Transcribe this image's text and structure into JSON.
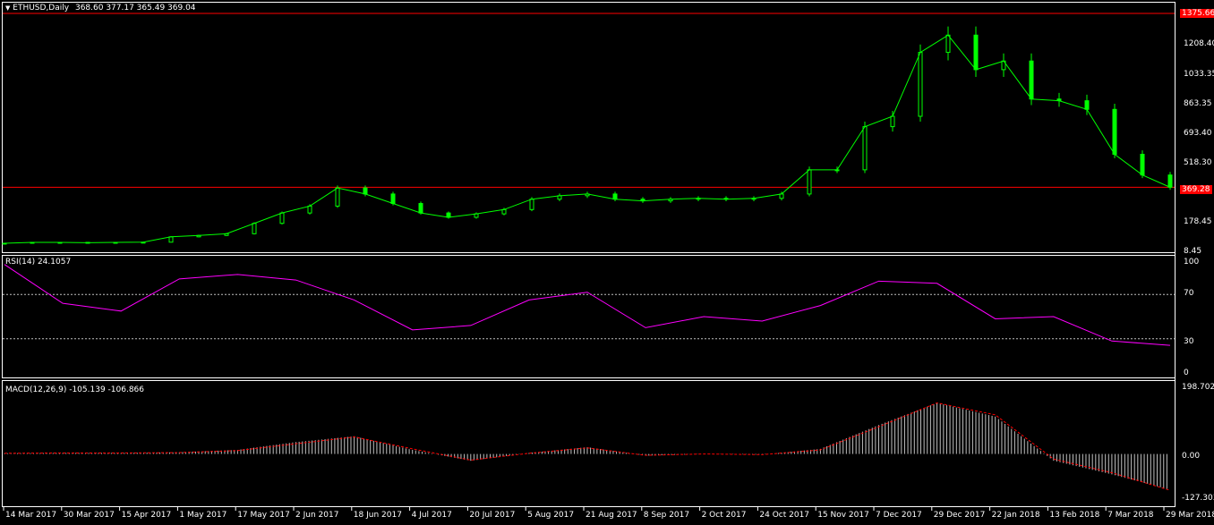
{
  "main": {
    "symbol_label": "ETHUSD,Daily",
    "ohlc_label": "368.60 377.17 365.49 369.04",
    "price_ticks": [
      "1208.40",
      "1033.35",
      "863.35",
      "693.40",
      "518.30",
      "178.45",
      "8.45"
    ],
    "price_tags": {
      "high": "1375.66",
      "low": "369.28"
    },
    "line_color": "#ff0000",
    "candle_color": "#00ff00"
  },
  "rsi": {
    "label": "RSI(14) 24.1057",
    "ticks": [
      "100",
      "70",
      "30",
      "0"
    ],
    "color": "#ff00ff"
  },
  "macd": {
    "label": "MACD(12,26,9) -105.139 -106.866",
    "ticks": [
      "198.702",
      "0.00",
      "-127.303"
    ],
    "signal_color": "#ff0000"
  },
  "x_axis": {
    "labels": [
      "14 Mar 2017",
      "30 Mar 2017",
      "15 Apr 2017",
      "1 May 2017",
      "17 May 2017",
      "2 Jun 2017",
      "18 Jun 2017",
      "4 Jul 2017",
      "20 Jul 2017",
      "5 Aug 2017",
      "21 Aug 2017",
      "8 Sep 2017",
      "2 Oct 2017",
      "24 Oct 2017",
      "15 Nov 2017",
      "7 Dec 2017",
      "29 Dec 2017",
      "22 Jan 2018",
      "13 Feb 2018",
      "7 Mar 2018",
      "29 Mar 2018"
    ]
  },
  "chart_data": [
    {
      "type": "line",
      "name": "ETHUSD,Daily",
      "ylim": [
        8.45,
        1375.66
      ],
      "x": [
        "14 Mar 2017",
        "22 Mar 2017",
        "30 Mar 2017",
        "7 Apr 2017",
        "15 Apr 2017",
        "23 Apr 2017",
        "1 May 2017",
        "9 May 2017",
        "17 May 2017",
        "25 May 2017",
        "2 Jun 2017",
        "10 Jun 2017",
        "18 Jun 2017",
        "26 Jun 2017",
        "4 Jul 2017",
        "12 Jul 2017",
        "20 Jul 2017",
        "28 Jul 2017",
        "5 Aug 2017",
        "13 Aug 2017",
        "21 Aug 2017",
        "29 Aug 2017",
        "8 Sep 2017",
        "20 Sep 2017",
        "2 Oct 2017",
        "13 Oct 2017",
        "24 Oct 2017",
        "4 Nov 2017",
        "15 Nov 2017",
        "26 Nov 2017",
        "7 Dec 2017",
        "18 Dec 2017",
        "29 Dec 2017",
        "5 Jan 2018",
        "13 Jan 2018",
        "22 Jan 2018",
        "1 Feb 2018",
        "13 Feb 2018",
        "24 Feb 2018",
        "7 Mar 2018",
        "18 Mar 2018",
        "29 Mar 2018",
        "2 Apr 2018"
      ],
      "close": [
        45,
        50,
        50,
        48,
        50,
        51,
        82,
        90,
        100,
        160,
        220,
        260,
        365,
        330,
        275,
        220,
        195,
        215,
        240,
        300,
        320,
        330,
        300,
        290,
        300,
        305,
        300,
        305,
        330,
        470,
        470,
        720,
        780,
        1150,
        1250,
        1050,
        1100,
        880,
        870,
        820,
        560,
        440,
        369.04
      ]
    },
    {
      "type": "line",
      "name": "RSI(14)",
      "ylim": [
        0,
        100
      ],
      "x": [
        "14 Mar 2017",
        "30 Mar 2017",
        "15 Apr 2017",
        "1 May 2017",
        "17 May 2017",
        "2 Jun 2017",
        "18 Jun 2017",
        "4 Jul 2017",
        "20 Jul 2017",
        "5 Aug 2017",
        "21 Aug 2017",
        "8 Sep 2017",
        "2 Oct 2017",
        "24 Oct 2017",
        "15 Nov 2017",
        "7 Dec 2017",
        "29 Dec 2017",
        "22 Jan 2018",
        "13 Feb 2018",
        "7 Mar 2018",
        "29 Mar 2018"
      ],
      "values": [
        97,
        62,
        55,
        84,
        88,
        83,
        65,
        38,
        42,
        65,
        72,
        40,
        50,
        46,
        60,
        82,
        80,
        48,
        50,
        28,
        24.1057
      ],
      "levels": [
        70,
        30
      ]
    },
    {
      "type": "bar",
      "name": "MACD(12,26,9)",
      "ylim": [
        -127.303,
        198.702
      ],
      "x": [
        "14 Mar 2017",
        "30 Mar 2017",
        "15 Apr 2017",
        "1 May 2017",
        "17 May 2017",
        "2 Jun 2017",
        "18 Jun 2017",
        "4 Jul 2017",
        "20 Jul 2017",
        "5 Aug 2017",
        "21 Aug 2017",
        "8 Sep 2017",
        "2 Oct 2017",
        "24 Oct 2017",
        "15 Nov 2017",
        "7 Dec 2017",
        "29 Dec 2017",
        "22 Jan 2018",
        "13 Feb 2018",
        "7 Mar 2018",
        "29 Mar 2018"
      ],
      "macd": [
        2,
        3,
        3,
        5,
        12,
        35,
        52,
        12,
        -20,
        3,
        20,
        -5,
        0,
        -2,
        15,
        85,
        150,
        110,
        -20,
        -60,
        -105.139
      ],
      "signal": [
        2,
        3,
        3,
        4,
        10,
        30,
        50,
        15,
        -18,
        2,
        18,
        -4,
        0,
        -2,
        12,
        80,
        150,
        115,
        -15,
        -55,
        -106.866
      ]
    }
  ]
}
